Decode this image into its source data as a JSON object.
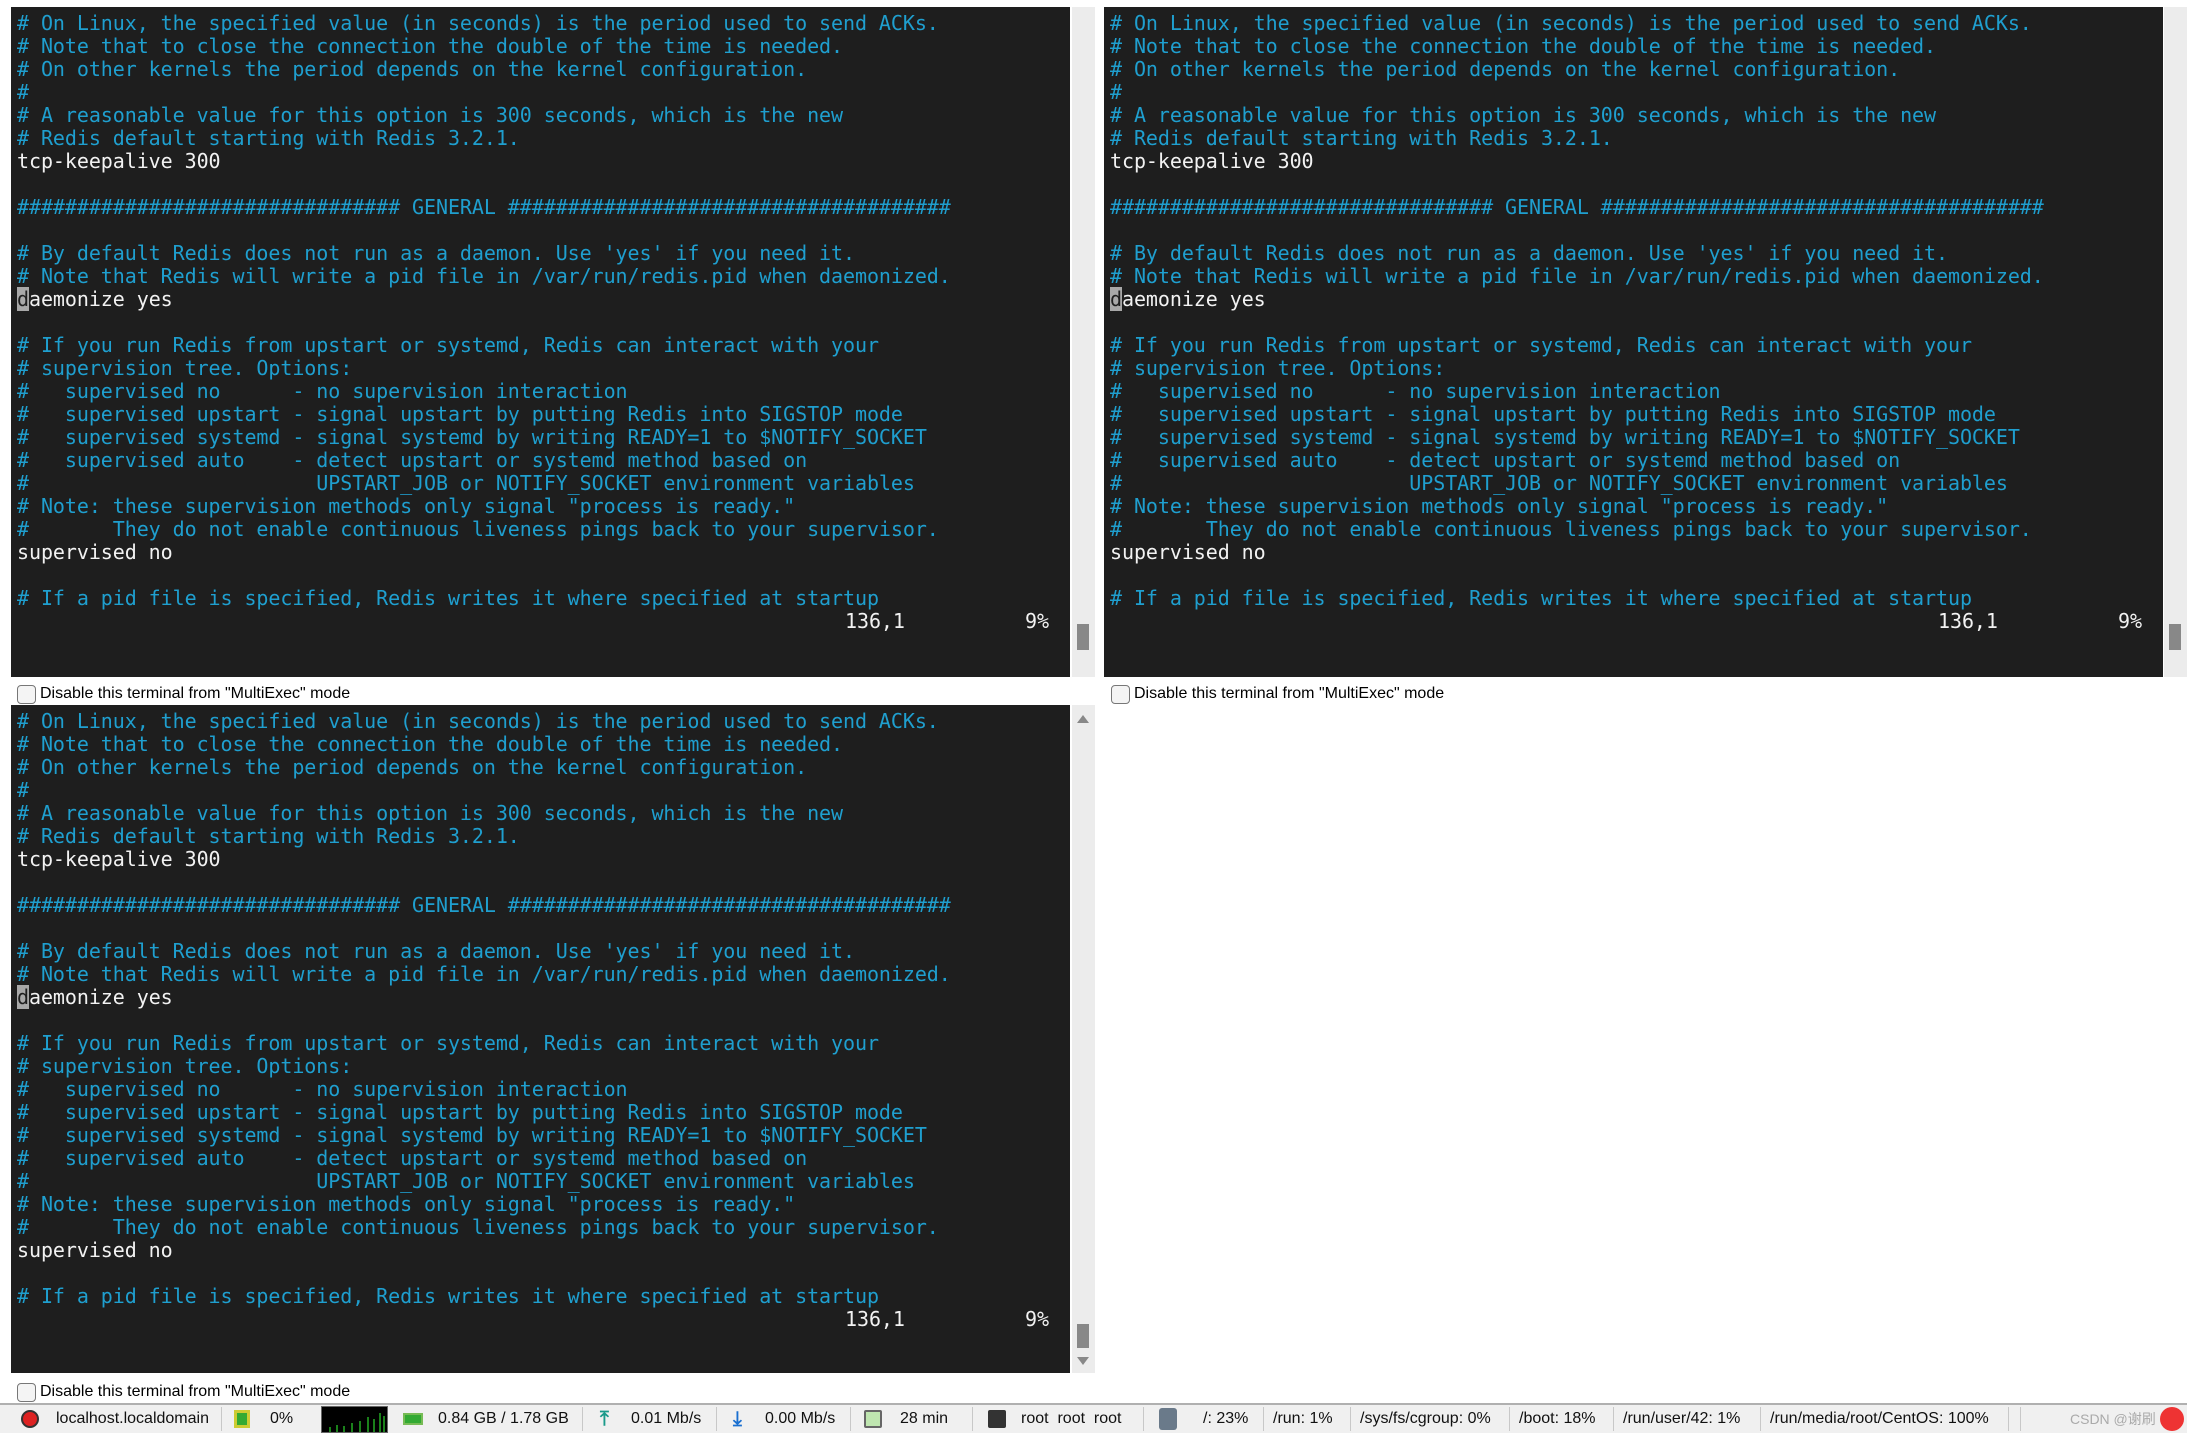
{
  "terminal": {
    "lines": [
      {
        "t": "# On Linux, the specified value (in seconds) is the period used to send ACKs.",
        "k": "c"
      },
      {
        "t": "# Note that to close the connection the double of the time is needed.",
        "k": "c"
      },
      {
        "t": "# On other kernels the period depends on the kernel configuration.",
        "k": "c"
      },
      {
        "t": "#",
        "k": "c"
      },
      {
        "t": "# A reasonable value for this option is 300 seconds, which is the new",
        "k": "c"
      },
      {
        "t": "# Redis default starting with Redis 3.2.1.",
        "k": "c"
      },
      {
        "t": "tcp-keepalive 300",
        "k": "w"
      },
      {
        "t": "",
        "k": "w"
      },
      {
        "t": "################################ GENERAL #####################################",
        "k": "c"
      },
      {
        "t": "",
        "k": "w"
      },
      {
        "t": "# By default Redis does not run as a daemon. Use 'yes' if you need it.",
        "k": "c"
      },
      {
        "t": "# Note that Redis will write a pid file in /var/run/redis.pid when daemonized.",
        "k": "c"
      },
      {
        "t": "daemonize yes",
        "k": "w",
        "cursor": true
      },
      {
        "t": "",
        "k": "w"
      },
      {
        "t": "# If you run Redis from upstart or systemd, Redis can interact with your",
        "k": "c"
      },
      {
        "t": "# supervision tree. Options:",
        "k": "c"
      },
      {
        "t": "#   supervised no      - no supervision interaction",
        "k": "c"
      },
      {
        "t": "#   supervised upstart - signal upstart by putting Redis into SIGSTOP mode",
        "k": "c"
      },
      {
        "t": "#   supervised systemd - signal systemd by writing READY=1 to $NOTIFY_SOCKET",
        "k": "c"
      },
      {
        "t": "#   supervised auto    - detect upstart or systemd method based on",
        "k": "c"
      },
      {
        "t": "#                        UPSTART_JOB or NOTIFY_SOCKET environment variables",
        "k": "c"
      },
      {
        "t": "# Note: these supervision methods only signal \"process is ready.\"",
        "k": "c"
      },
      {
        "t": "#       They do not enable continuous liveness pings back to your supervisor.",
        "k": "c"
      },
      {
        "t": "supervised no",
        "k": "w"
      },
      {
        "t": "",
        "k": "w"
      },
      {
        "t": "# If a pid file is specified, Redis writes it where specified at startup",
        "k": "c"
      }
    ],
    "position": "136,1",
    "percent": "9%",
    "scroll_fraction": 0.09
  },
  "multiexec_label": "Disable this terminal from \"MultiExec\" mode",
  "statusbar": {
    "hostname": "localhost.localdomain",
    "cpu": "0%",
    "memory": "0.84 GB / 1.78 GB",
    "upload": "0.01 Mb/s",
    "download": "0.00 Mb/s",
    "uptime": "28 min",
    "users": "root  root  root",
    "disks": [
      "/: 23%",
      "/run: 1%",
      "/sys/fs/cgroup: 0%",
      "/boot: 18%",
      "/run/user/42: 1%",
      "/run/media/root/CentOS: 100%"
    ],
    "watermark": "CSDN @谢刷"
  },
  "colors": {
    "comment": "#1f9fcf",
    "text": "#f2f2f2",
    "terminal_bg": "#1e1e1e"
  }
}
